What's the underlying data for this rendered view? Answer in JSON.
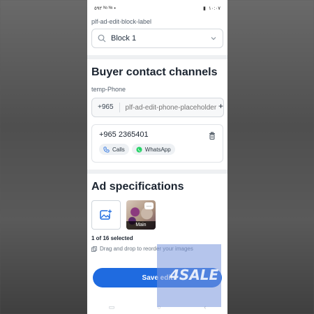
{
  "status": {
    "left": "٥٩٢ ᴺᵃ ᴺᵃ •",
    "time": "١٠:٠٧"
  },
  "form": {
    "block_label": "plf-ad-edit-block-label",
    "block_value": "Block 1"
  },
  "contacts": {
    "heading": "Buyer contact channels",
    "phone_label": "temp-Phone",
    "country_code": "+965",
    "phone_placeholder": "plf-ad-edit-phone-placeholder",
    "plus": "+",
    "entry_number": "+965 2365401",
    "chip_calls": "Calls",
    "chip_whatsapp": "WhatsApp"
  },
  "specs": {
    "heading": "Ad specifications",
    "more_label": "…",
    "main_label": "Main",
    "selected_count": "1 of 16 selected",
    "hint": "Drag and drop to reorder your images"
  },
  "actions": {
    "save_label": "Save edit"
  },
  "watermark": {
    "text": "4SALE"
  },
  "colors": {
    "primary": "#1f6be0",
    "whatsapp": "#25d366",
    "text": "#1b2430"
  }
}
